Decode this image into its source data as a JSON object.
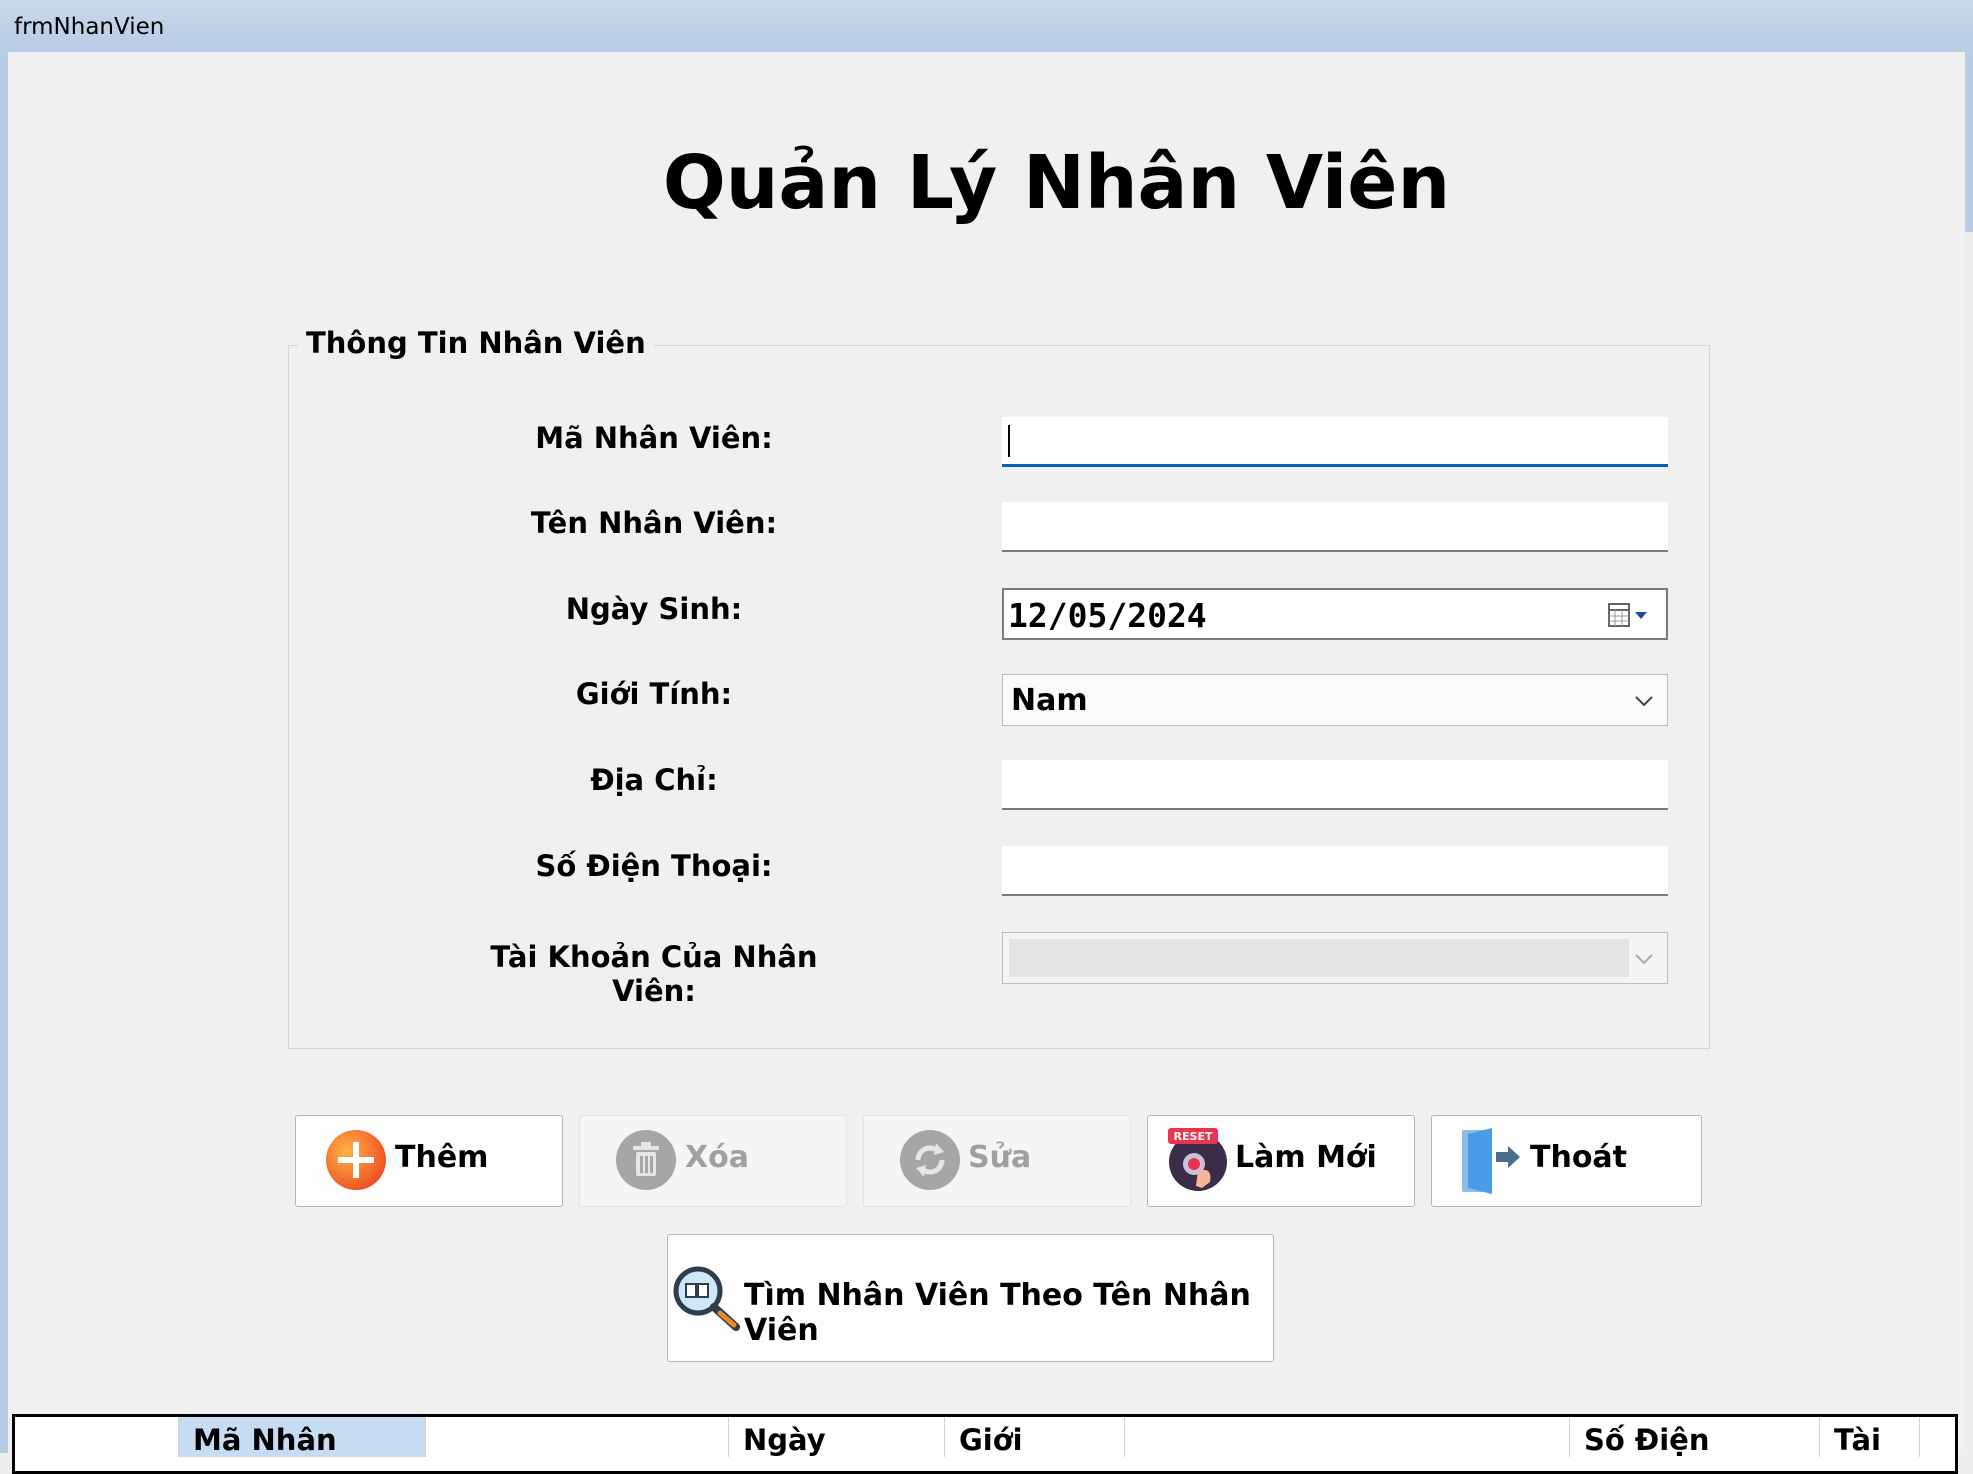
{
  "window": {
    "title": "frmNhanVien"
  },
  "heading": "Quản Lý Nhân Viên",
  "group": {
    "title": "Thông Tin Nhân Viên"
  },
  "form": {
    "ma_nv_label": "Mã Nhân Viên:",
    "ma_nv_value": "",
    "ten_nv_label": "Tên Nhân Viên:",
    "ten_nv_value": "",
    "ngay_sinh_label": "Ngày Sinh:",
    "ngay_sinh_value": "12/05/2024",
    "gioi_tinh_label": "Giới Tính:",
    "gioi_tinh_value": "Nam",
    "dia_chi_label": "Địa Chỉ:",
    "dia_chi_value": "",
    "sdt_label": "Số Điện Thoại:",
    "sdt_value": "",
    "tai_khoan_label": "Tài Khoản Của Nhân Viên:",
    "tai_khoan_value": ""
  },
  "buttons": {
    "them": "Thêm",
    "xoa": "Xóa",
    "sua": "Sửa",
    "lam_moi": "Làm Mới",
    "thoat": "Thoát",
    "tim": "Tìm Nhân Viên Theo Tên Nhân Viên",
    "reset_badge": "RESET"
  },
  "grid": {
    "columns": [
      "Mã Nhân",
      "Ngày",
      "Giới",
      "Số Điện",
      "Tài"
    ]
  },
  "colors": {
    "accent_focus": "#0060c0",
    "add_orange": "#f58220",
    "disabled_gray": "#a0a0a0",
    "selected_header": "#c6dcf2"
  }
}
